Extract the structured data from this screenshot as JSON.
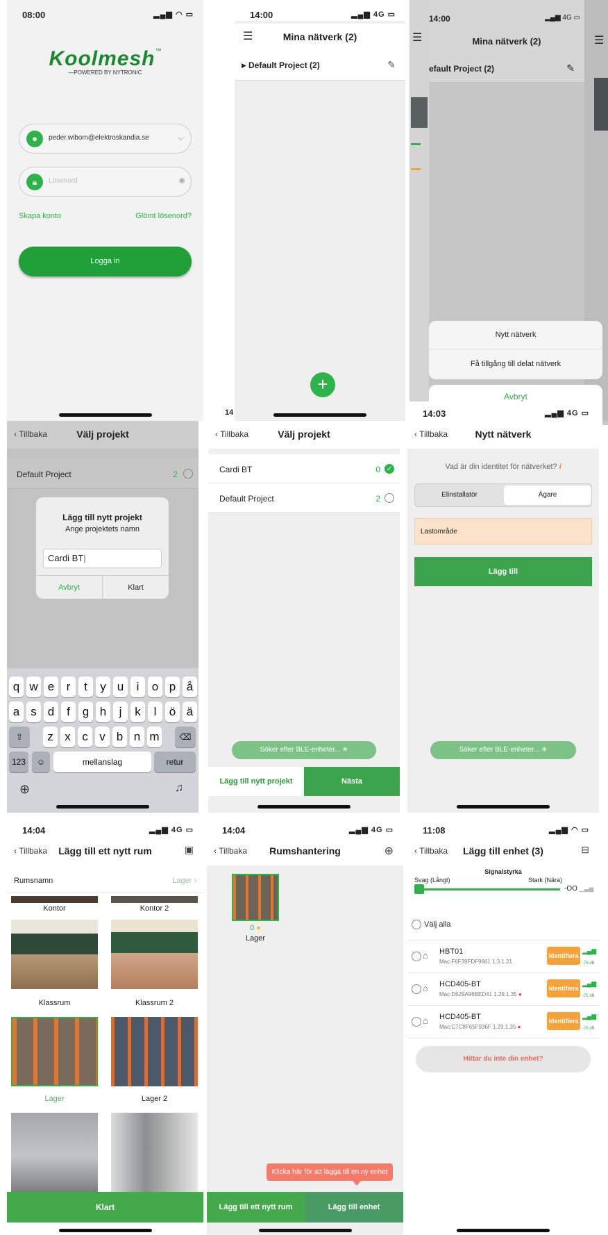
{
  "s1": {
    "time": "08:00",
    "logo": "Koolmesh",
    "tm": "™",
    "powered_by": "—POWERED BY NYTRONIC",
    "email": "peder.wibom@elektroskandia.se",
    "password_placeholder": "Lösenord",
    "create_account": "Skapa konto",
    "forgot_password": "Glömt lösenord?",
    "login": "Logga in"
  },
  "s2": {
    "time": "14:00",
    "network": "4G",
    "title": "Mina nätverk (2)",
    "project": "Default Project (2)",
    "partial_time": "14"
  },
  "s3": {
    "time": "14:00",
    "network": "4G",
    "title": "Mina nätverk (2)",
    "project": "efault Project (2)",
    "sheet_new": "Nytt nätverk",
    "sheet_shared": "Få tillgång till delat nätverk",
    "sheet_cancel": "Avbryt"
  },
  "s4": {
    "back": "Tillbaka",
    "title": "Välj projekt",
    "row_name": "Default Project",
    "row_count": "2",
    "dialog_title": "Lägg till nytt projekt",
    "dialog_sub": "Ange projektets namn",
    "dialog_value": "Cardi BT",
    "dialog_cancel": "Avbryt",
    "dialog_ok": "Klart",
    "keys_row1": [
      "q",
      "w",
      "e",
      "r",
      "t",
      "y",
      "u",
      "i",
      "o",
      "p",
      "å"
    ],
    "keys_row2": [
      "a",
      "s",
      "d",
      "f",
      "g",
      "h",
      "j",
      "k",
      "l",
      "ö",
      "ä"
    ],
    "keys_row3": [
      "z",
      "x",
      "c",
      "v",
      "b",
      "n",
      "m"
    ],
    "key_123": "123",
    "key_space": "mellanslag",
    "key_return": "retur"
  },
  "s5": {
    "back": "Tillbaka",
    "title": "Välj projekt",
    "row1_name": "Cardi BT",
    "row1_count": "0",
    "row2_name": "Default Project",
    "row2_count": "2",
    "searching": "Söker efter BLE-enheter...",
    "add_project": "Lägg till nytt projekt",
    "next": "Nästa"
  },
  "s6": {
    "time": "14:03",
    "network": "4G",
    "back": "Tillbaka",
    "title": "Nytt nätverk",
    "question": "Vad är din identitet för nätverket?",
    "seg_installer": "Elinstallatör",
    "seg_owner": "Ägare",
    "field_value": "Lastområde",
    "add": "Lägg till",
    "searching": "Söker efter BLE-enheter..."
  },
  "s7": {
    "time": "14:04",
    "network": "4G",
    "back": "Tillbaka",
    "title": "Lägg till ett nytt rum",
    "room_name_label": "Rumsnamn",
    "room_name_value": "Lager",
    "rooms": [
      "Kontor",
      "Kontor 2",
      "Klassrum",
      "Klassrum 2",
      "Lager",
      "Lager 2"
    ],
    "done": "Klart"
  },
  "s8": {
    "time": "14:04",
    "network": "4G",
    "back": "Tillbaka",
    "title": "Rumshantering",
    "room_count": "0",
    "room_name": "Lager",
    "tooltip": "Klicka här för att lägga till en ny enhet",
    "add_room": "Lägg till ett nytt rum",
    "add_device": "Lägg till enhet"
  },
  "s9": {
    "time": "11:08",
    "back": "Tillbaka",
    "title": "Lägg till enhet (3)",
    "signal_title": "Signalstyrka",
    "weak": "Svag (Långt)",
    "strong": "Stark (Nära)",
    "signal_value": "-OO",
    "select_all": "Välj alla",
    "devices": [
      {
        "name": "HBT01",
        "mac": "Mac:F6F39FDF9661  1.3.1.21",
        "identify": "Identifiera",
        "db": "-75 dB"
      },
      {
        "name": "HCD405-BT",
        "mac": "Mac:D629A96BED41  1.29.1.35",
        "identify": "Identifiera",
        "db": "-75 dB"
      },
      {
        "name": "HCD405-BT",
        "mac": "Mac:C7C8F65F936F  1.29.1.35",
        "identify": "Identifiera",
        "db": "-79 dB"
      }
    ],
    "not_found": "Hittar du inte din enhet?"
  },
  "colors": {
    "brand_green": "#2a9d3a",
    "orange": "#f5a23a",
    "tooltip": "#f47a6a"
  }
}
